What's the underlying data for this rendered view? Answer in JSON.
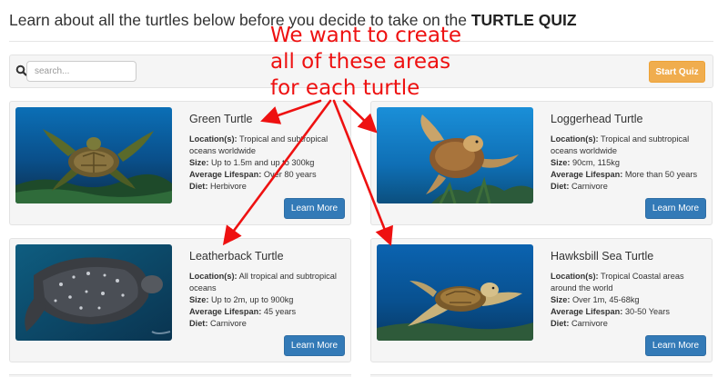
{
  "header": {
    "title_prefix": "Learn about all the turtles below before you decide to take on the ",
    "title_emphasis": "TURTLE QUIZ"
  },
  "toolbar": {
    "search_placeholder": "search...",
    "search_value": "",
    "search_icon": "search-icon",
    "start_quiz_label": "Start Quiz"
  },
  "labels": {
    "location": "Location(s):",
    "size": "Size:",
    "lifespan": "Average Lifespan:",
    "diet": "Diet:"
  },
  "turtles": [
    {
      "name": "Green Turtle",
      "location": "Tropical and subtropical oceans worldwide",
      "size": "Up to 1.5m and up to 300kg",
      "lifespan": "Over 80 years",
      "diet": "Herbivore",
      "button": "Learn More"
    },
    {
      "name": "Loggerhead Turtle",
      "location": "Tropical and subtropical oceans worldwide",
      "size": "90cm, 115kg",
      "lifespan": "More than 50 years",
      "diet": "Carnivore",
      "button": "Learn More"
    },
    {
      "name": "Leatherback Turtle",
      "location": "All tropical and subtropical oceans",
      "size": "Up to 2m, up to 900kg",
      "lifespan": "45 years",
      "diet": "Carnivore",
      "button": "Learn More"
    },
    {
      "name": "Hawksbill Sea Turtle",
      "location": "Tropical Coastal areas around the world",
      "size": "Over 1m, 45-68kg",
      "lifespan": "30-50 Years",
      "diet": "Carnivore",
      "button": "Learn More"
    }
  ],
  "annotation": {
    "lines": [
      "We want to create",
      "all of these areas",
      "for each turtle"
    ],
    "color": "#ee1111"
  },
  "colors": {
    "start_button": "#f0ad4e",
    "learn_button": "#337ab7",
    "card_background": "#f5f5f5"
  }
}
